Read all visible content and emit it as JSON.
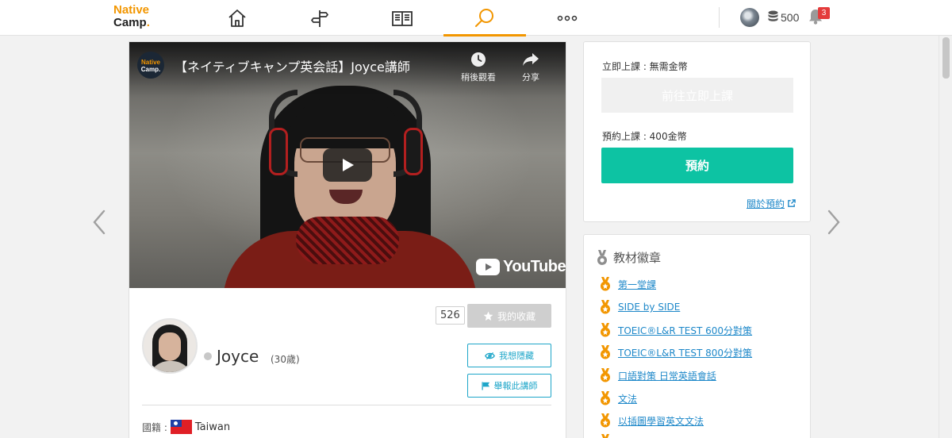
{
  "header": {
    "logo_line1": "Native",
    "logo_line2": "Camp",
    "logo_dot": ".",
    "nav": [
      {
        "name": "home",
        "icon": "home-icon"
      },
      {
        "name": "guide",
        "icon": "signpost-icon"
      },
      {
        "name": "textbook",
        "icon": "book-icon"
      },
      {
        "name": "search",
        "icon": "search-icon",
        "active": true
      },
      {
        "name": "more",
        "icon": "more-icon"
      }
    ],
    "coin_count": "500",
    "notification_count": "3"
  },
  "video": {
    "channel_logo_line1": "Native",
    "channel_logo_line2": "Camp.",
    "title": "【ネイティブキャンプ英会話】Joyce講師",
    "watch_later": "稍後觀看",
    "share": "分享",
    "brand": "YouTube"
  },
  "teacher": {
    "name": "Joyce",
    "age": "(30歲)",
    "favorite_count": "526",
    "favorite_label": "我的收藏",
    "hide_label": "我想隱藏",
    "report_label": "舉報此講師",
    "nationality_label": "國籍 :",
    "country": "Taiwan"
  },
  "booking": {
    "instant_label": "立即上課 : 無需金幣",
    "instant_button": "前往立即上課",
    "reserve_label": "預約上課 : 400金幣",
    "reserve_button": "預約",
    "about_link": "關於預約"
  },
  "badges": {
    "title": "教材徽章",
    "items": [
      "第一堂課",
      "SIDE by SIDE",
      "TOEIC®L&R TEST 600分對策",
      "TOEIC®L&R TEST 800分對策",
      "口語對策 日常英語會話",
      "文法",
      "以插圖學習英文文法"
    ]
  },
  "colors": {
    "brand_orange": "#f29600",
    "booking_green": "#0dc3a3",
    "link_blue": "#1e88c9",
    "outline_blue": "#1ea6c9",
    "badge_red": "#e43b3b"
  }
}
